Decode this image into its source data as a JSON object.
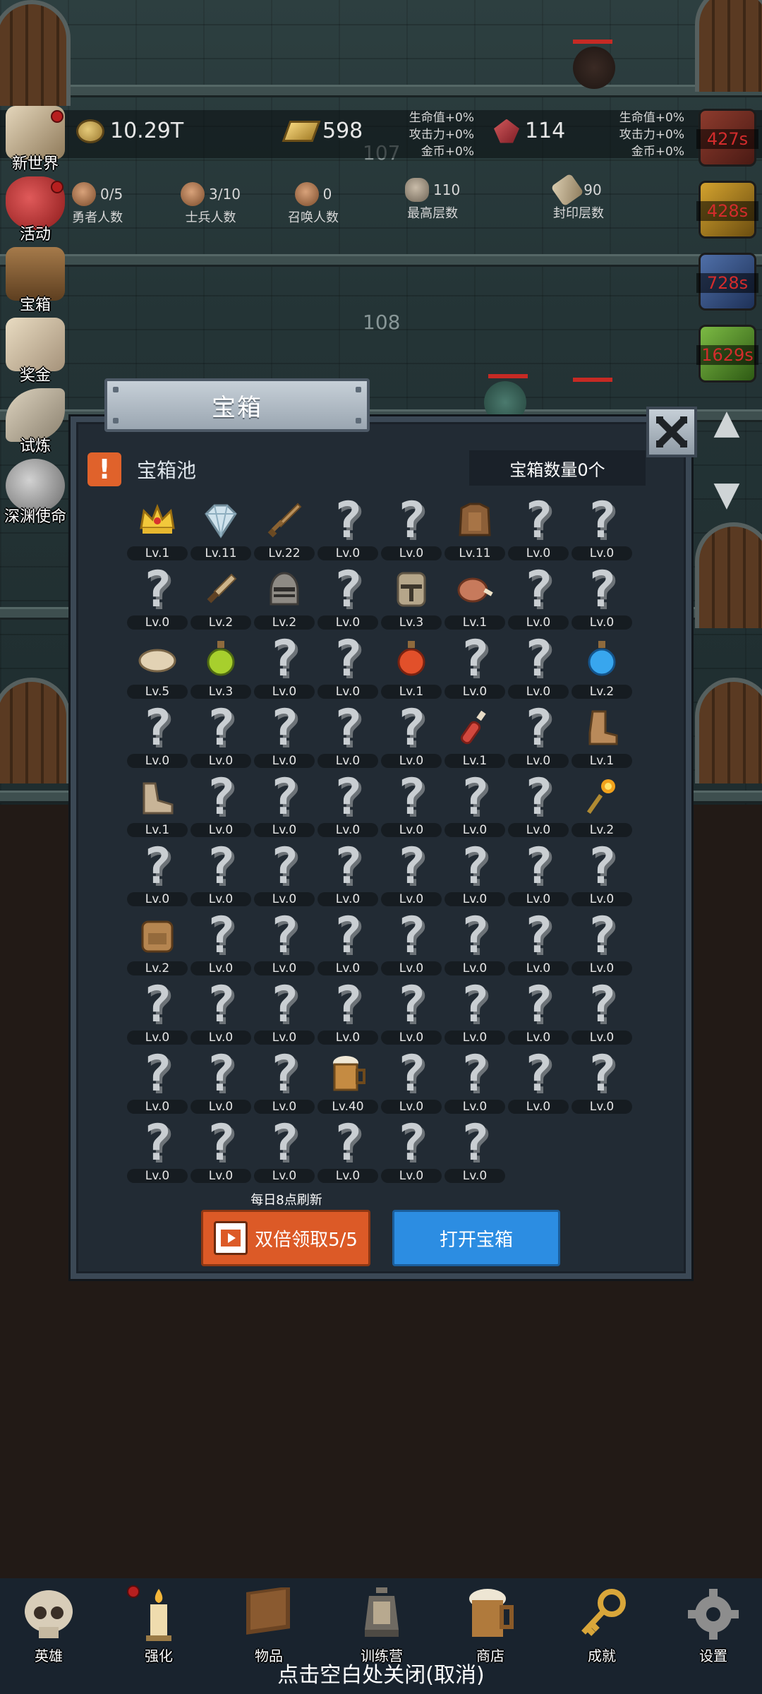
{
  "resources": {
    "gold": "10.29T",
    "gold_bar": "598",
    "gem": "114",
    "bonus_left": [
      "生命值+0%",
      "攻击力+0%",
      "金币+0%"
    ],
    "bonus_right": [
      "生命值+0%",
      "攻击力+0%",
      "金币+0%"
    ]
  },
  "counts": [
    {
      "value": "0/5",
      "label": "勇者人数",
      "icon": "hero-portrait-icon"
    },
    {
      "value": "3/10",
      "label": "士兵人数",
      "icon": "soldier-portrait-icon"
    },
    {
      "value": "0",
      "label": "召唤人数",
      "icon": "summon-portrait-icon"
    },
    {
      "value": "110",
      "label": "最高层数",
      "icon": "stone-icon"
    },
    {
      "value": "90",
      "label": "封印层数",
      "icon": "scroll-icon"
    }
  ],
  "floors": {
    "f107": "107",
    "f108": "108"
  },
  "left_menu": [
    {
      "label": "新世界",
      "icon": "map-icon",
      "dot": true
    },
    {
      "label": "活动",
      "icon": "heart-icon",
      "dot": true
    },
    {
      "label": "宝箱",
      "icon": "chest-icon",
      "dot": false
    },
    {
      "label": "奖金",
      "icon": "envelope-icon",
      "dot": false
    },
    {
      "label": "试炼",
      "icon": "feather-icon",
      "dot": false
    },
    {
      "label": "深渊使命",
      "icon": "orb-icon",
      "dot": false
    }
  ],
  "right_timers": [
    "427s",
    "428s",
    "728s",
    "1629s"
  ],
  "dialog": {
    "title": "宝箱",
    "pool_title": "宝箱池",
    "chest_count": "宝箱数量0个",
    "refresh_note": "每日8点刷新",
    "double_claim": "双倍领取5/5",
    "open_chest": "打开宝箱"
  },
  "items": [
    {
      "icon": "crown",
      "lv": "Lv.1"
    },
    {
      "icon": "diamond",
      "lv": "Lv.11"
    },
    {
      "icon": "sword",
      "lv": "Lv.22"
    },
    {
      "icon": "unknown",
      "lv": "Lv.0"
    },
    {
      "icon": "unknown",
      "lv": "Lv.0"
    },
    {
      "icon": "armor",
      "lv": "Lv.11"
    },
    {
      "icon": "unknown",
      "lv": "Lv.0"
    },
    {
      "icon": "unknown",
      "lv": "Lv.0"
    },
    {
      "icon": "unknown",
      "lv": "Lv.0"
    },
    {
      "icon": "dagger",
      "lv": "Lv.2"
    },
    {
      "icon": "helmet",
      "lv": "Lv.2"
    },
    {
      "icon": "unknown",
      "lv": "Lv.0"
    },
    {
      "icon": "great-helm",
      "lv": "Lv.3"
    },
    {
      "icon": "meat",
      "lv": "Lv.1"
    },
    {
      "icon": "unknown",
      "lv": "Lv.0"
    },
    {
      "icon": "unknown",
      "lv": "Lv.0"
    },
    {
      "icon": "bread",
      "lv": "Lv.5"
    },
    {
      "icon": "green-potion",
      "lv": "Lv.3"
    },
    {
      "icon": "unknown",
      "lv": "Lv.0"
    },
    {
      "icon": "unknown",
      "lv": "Lv.0"
    },
    {
      "icon": "red-potion",
      "lv": "Lv.1"
    },
    {
      "icon": "unknown",
      "lv": "Lv.0"
    },
    {
      "icon": "unknown",
      "lv": "Lv.0"
    },
    {
      "icon": "blue-potion",
      "lv": "Lv.2"
    },
    {
      "icon": "unknown",
      "lv": "Lv.0"
    },
    {
      "icon": "unknown",
      "lv": "Lv.0"
    },
    {
      "icon": "unknown",
      "lv": "Lv.0"
    },
    {
      "icon": "unknown",
      "lv": "Lv.0"
    },
    {
      "icon": "unknown",
      "lv": "Lv.0"
    },
    {
      "icon": "red-vial",
      "lv": "Lv.1"
    },
    {
      "icon": "unknown",
      "lv": "Lv.0"
    },
    {
      "icon": "boot",
      "lv": "Lv.1"
    },
    {
      "icon": "shoe",
      "lv": "Lv.1"
    },
    {
      "icon": "unknown",
      "lv": "Lv.0"
    },
    {
      "icon": "unknown",
      "lv": "Lv.0"
    },
    {
      "icon": "unknown",
      "lv": "Lv.0"
    },
    {
      "icon": "unknown",
      "lv": "Lv.0"
    },
    {
      "icon": "unknown",
      "lv": "Lv.0"
    },
    {
      "icon": "unknown",
      "lv": "Lv.0"
    },
    {
      "icon": "torch",
      "lv": "Lv.2"
    },
    {
      "icon": "unknown",
      "lv": "Lv.0"
    },
    {
      "icon": "unknown",
      "lv": "Lv.0"
    },
    {
      "icon": "unknown",
      "lv": "Lv.0"
    },
    {
      "icon": "unknown",
      "lv": "Lv.0"
    },
    {
      "icon": "unknown",
      "lv": "Lv.0"
    },
    {
      "icon": "unknown",
      "lv": "Lv.0"
    },
    {
      "icon": "unknown",
      "lv": "Lv.0"
    },
    {
      "icon": "unknown",
      "lv": "Lv.0"
    },
    {
      "icon": "backpack",
      "lv": "Lv.2"
    },
    {
      "icon": "unknown",
      "lv": "Lv.0"
    },
    {
      "icon": "unknown",
      "lv": "Lv.0"
    },
    {
      "icon": "unknown",
      "lv": "Lv.0"
    },
    {
      "icon": "unknown",
      "lv": "Lv.0"
    },
    {
      "icon": "unknown",
      "lv": "Lv.0"
    },
    {
      "icon": "unknown",
      "lv": "Lv.0"
    },
    {
      "icon": "unknown",
      "lv": "Lv.0"
    },
    {
      "icon": "unknown",
      "lv": "Lv.0"
    },
    {
      "icon": "unknown",
      "lv": "Lv.0"
    },
    {
      "icon": "unknown",
      "lv": "Lv.0"
    },
    {
      "icon": "unknown",
      "lv": "Lv.0"
    },
    {
      "icon": "unknown",
      "lv": "Lv.0"
    },
    {
      "icon": "unknown",
      "lv": "Lv.0"
    },
    {
      "icon": "unknown",
      "lv": "Lv.0"
    },
    {
      "icon": "unknown",
      "lv": "Lv.0"
    },
    {
      "icon": "unknown",
      "lv": "Lv.0"
    },
    {
      "icon": "unknown",
      "lv": "Lv.0"
    },
    {
      "icon": "unknown",
      "lv": "Lv.0"
    },
    {
      "icon": "beer",
      "lv": "Lv.40"
    },
    {
      "icon": "unknown",
      "lv": "Lv.0"
    },
    {
      "icon": "unknown",
      "lv": "Lv.0"
    },
    {
      "icon": "unknown",
      "lv": "Lv.0"
    },
    {
      "icon": "unknown",
      "lv": "Lv.0"
    },
    {
      "icon": "unknown",
      "lv": "Lv.0"
    },
    {
      "icon": "unknown",
      "lv": "Lv.0"
    },
    {
      "icon": "unknown",
      "lv": "Lv.0"
    },
    {
      "icon": "unknown",
      "lv": "Lv.0"
    },
    {
      "icon": "unknown",
      "lv": "Lv.0"
    },
    {
      "icon": "unknown",
      "lv": "Lv.0"
    }
  ],
  "bottom_nav": [
    {
      "label": "英雄",
      "icon": "skull-icon",
      "dot": false
    },
    {
      "label": "强化",
      "icon": "candle-icon",
      "dot": true
    },
    {
      "label": "物品",
      "icon": "book-icon",
      "dot": false
    },
    {
      "label": "训练营",
      "icon": "lantern-icon",
      "dot": false
    },
    {
      "label": "商店",
      "icon": "beer-mug-icon",
      "dot": false
    },
    {
      "label": "成就",
      "icon": "key-icon",
      "dot": false
    },
    {
      "label": "设置",
      "icon": "gear-icon",
      "dot": false
    }
  ],
  "close_hint": "点击空白处关闭(取消)",
  "colors": {
    "dialog_bg": "#222b34",
    "orange_button": "#dc5a27",
    "blue_button": "#2c8de2",
    "timer_red": "#d32c2c"
  }
}
